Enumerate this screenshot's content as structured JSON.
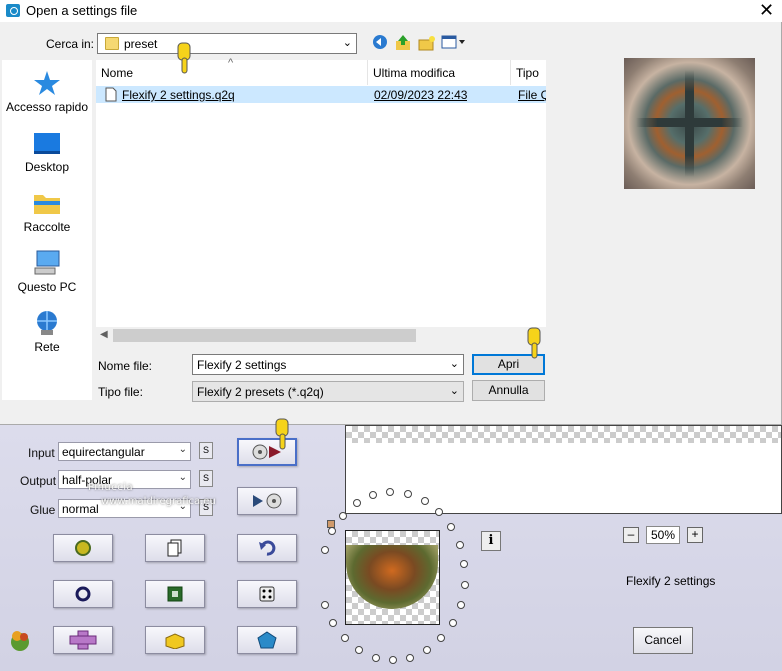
{
  "dialog": {
    "title": "Open a settings file",
    "close_glyph": "✕",
    "look_in_label": "Cerca in:",
    "look_in_value": "preset",
    "nav_icons": [
      "back-arrow-icon",
      "up-folder-icon",
      "new-folder-icon",
      "view-menu-icon"
    ],
    "places": [
      {
        "label": "Accesso rapido",
        "icon": "star-icon"
      },
      {
        "label": "Desktop",
        "icon": "desktop-icon"
      },
      {
        "label": "Raccolte",
        "icon": "folder-icon"
      },
      {
        "label": "Questo PC",
        "icon": "computer-icon"
      },
      {
        "label": "Rete",
        "icon": "network-icon"
      }
    ],
    "columns": [
      "Nome",
      "Ultima modifica",
      "Tipo"
    ],
    "files": [
      {
        "name": "Flexify 2 settings.q2q",
        "modified": "02/09/2023 22:43",
        "type": "File Q"
      }
    ],
    "filename_label": "Nome file:",
    "filename_value": "Flexify 2 settings",
    "filetype_label": "Tipo file:",
    "filetype_value": "Flexify 2 presets (*.q2q)",
    "open_button": "Apri",
    "cancel_button": "Annulla"
  },
  "plugin": {
    "input_label": "Input",
    "input_value": "equirectangular",
    "output_label": "Output",
    "output_value": "half-polar",
    "glue_label": "Glue",
    "glue_value": "normal",
    "s_label": "S",
    "zoom_minus": "–",
    "zoom_value": "50%",
    "zoom_plus": "+",
    "info_glyph": "i",
    "preset_name": "Flexify 2 settings",
    "cancel_button": "Cancel",
    "watermark_line1": "Pinuccia",
    "watermark_line2": "www.maldiregrafica.eu"
  },
  "colors": {
    "accent": "#0078d7",
    "selection": "#cce8ff",
    "hand_yellow": "#f6d31a"
  }
}
